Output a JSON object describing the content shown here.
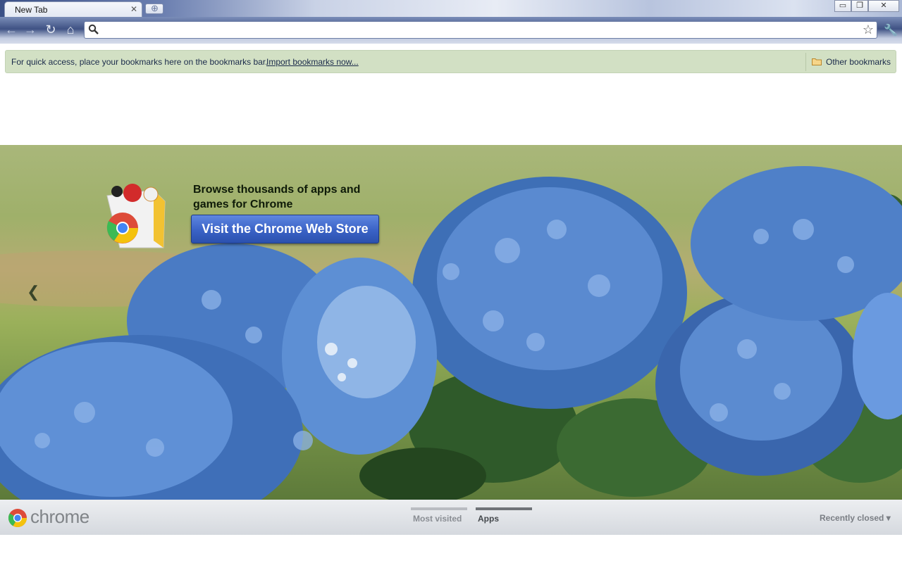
{
  "tab": {
    "title": "New Tab"
  },
  "window_controls": {
    "minimize": "▭",
    "restore": "❐",
    "close": "✕"
  },
  "toolbar": {
    "back_icon": "back-arrow-icon",
    "forward_icon": "forward-arrow-icon",
    "reload_icon": "reload-icon",
    "home_icon": "home-icon",
    "omnibox_value": "",
    "star_icon": "star-icon",
    "wrench_icon": "wrench-icon"
  },
  "bookmarks_bar": {
    "hint": "For quick access, place your bookmarks here on the bookmarks bar.",
    "import_link": "Import bookmarks now...",
    "other_bookmarks": "Other bookmarks"
  },
  "promo": {
    "text": "Browse thousands of apps and games for Chrome",
    "button": "Visit the Chrome Web Store"
  },
  "footer": {
    "brand": "chrome",
    "sections": [
      {
        "label": "Most visited",
        "selected": false
      },
      {
        "label": "Apps",
        "selected": true
      }
    ],
    "recently_closed": "Recently closed ▾"
  },
  "colors": {
    "promo_button": "#3a62c6",
    "bookmarks_bar": "#d2e0c4",
    "flowers": "#5a8ad0"
  }
}
